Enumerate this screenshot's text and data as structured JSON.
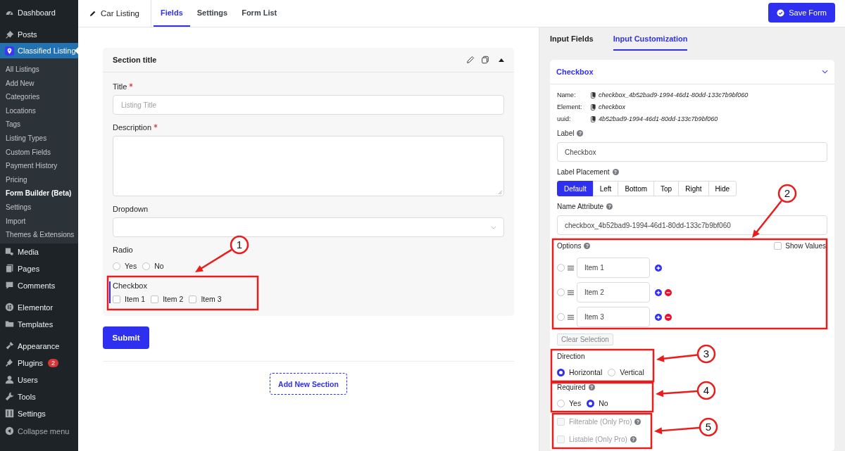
{
  "sidebar": {
    "groups": [
      {
        "items": [
          {
            "label": "Dashboard",
            "selected": false
          }
        ]
      },
      {
        "items": [
          {
            "label": "Posts",
            "selected": false
          },
          {
            "label": "Classified Listing",
            "selected": true,
            "children": [
              {
                "label": "All Listings",
                "selected": false
              },
              {
                "label": "Add New",
                "selected": false
              },
              {
                "label": "Categories",
                "selected": false
              },
              {
                "label": "Locations",
                "selected": false
              },
              {
                "label": "Tags",
                "selected": false
              },
              {
                "label": "Listing Types",
                "selected": false
              },
              {
                "label": "Custom Fields",
                "selected": false
              },
              {
                "label": "Payment History",
                "selected": false
              },
              {
                "label": "Pricing",
                "selected": false
              },
              {
                "label": "Form Builder (Beta)",
                "selected": true
              },
              {
                "label": "Settings",
                "selected": false
              },
              {
                "label": "Import",
                "selected": false
              },
              {
                "label": "Themes & Extensions",
                "selected": false
              }
            ]
          },
          {
            "label": "Media",
            "selected": false
          },
          {
            "label": "Pages",
            "selected": false
          },
          {
            "label": "Comments",
            "selected": false
          }
        ]
      },
      {
        "items": [
          {
            "label": "Elementor",
            "selected": false
          },
          {
            "label": "Templates",
            "selected": false
          }
        ]
      },
      {
        "items": [
          {
            "label": "Appearance",
            "selected": false
          },
          {
            "label": "Plugins",
            "selected": false,
            "badge": "2"
          },
          {
            "label": "Users",
            "selected": false
          },
          {
            "label": "Tools",
            "selected": false
          },
          {
            "label": "Settings",
            "selected": false
          }
        ]
      }
    ],
    "collapse": "Collapse menu"
  },
  "topbar": {
    "form_name": "Car Listing",
    "tabs": [
      {
        "label": "Fields",
        "selected": true
      },
      {
        "label": "Settings",
        "selected": false
      },
      {
        "label": "Form List",
        "selected": false
      }
    ],
    "save_button": "Save Form"
  },
  "section": {
    "title": "Section title",
    "fields": [
      {
        "kind": "text",
        "label": "Title",
        "required": true,
        "placeholder": "Listing Title"
      },
      {
        "kind": "textarea",
        "label": "Description",
        "required": true
      },
      {
        "kind": "select",
        "label": "Dropdown",
        "required": false
      },
      {
        "kind": "radio",
        "label": "Radio",
        "required": false,
        "options": [
          {
            "label": "Yes",
            "selected": false
          },
          {
            "label": "No",
            "selected": false
          }
        ]
      },
      {
        "kind": "checkbox",
        "label": "Checkbox",
        "required": false,
        "active": true,
        "options": [
          {
            "label": "Item 1",
            "checked": false
          },
          {
            "label": "Item 2",
            "checked": false
          },
          {
            "label": "Item 3",
            "checked": false
          }
        ]
      }
    ]
  },
  "submit_button": "Submit",
  "add_section_button": "Add New Section",
  "panel": {
    "tabs": [
      {
        "label": "Input Fields",
        "selected": false
      },
      {
        "label": "Input Customization",
        "selected": true
      }
    ],
    "card": {
      "title": "Checkbox",
      "expanded": true,
      "meta": [
        {
          "key": "Name:",
          "value": "checkbox_4b52bad9-1994-46d1-80dd-133c7b9bf060"
        },
        {
          "key": "Element:",
          "value": "checkbox"
        },
        {
          "key": "uuid:",
          "value": "4b52bad9-1994-46d1-80dd-133c7b9bf060"
        }
      ],
      "label_field": {
        "label": "Label",
        "help": "?",
        "value": "Checkbox"
      },
      "label_placement": {
        "label": "Label Placement",
        "help": "?",
        "options": [
          {
            "label": "Default",
            "selected": true
          },
          {
            "label": "Left",
            "selected": false
          },
          {
            "label": "Bottom",
            "selected": false
          },
          {
            "label": "Top",
            "selected": false
          },
          {
            "label": "Right",
            "selected": false
          },
          {
            "label": "Hide",
            "selected": false
          }
        ]
      },
      "name_attribute": {
        "label": "Name Attribute",
        "help": "?",
        "value": "checkbox_4b52bad9-1994-46d1-80dd-133c7b9bf060"
      },
      "options": {
        "label": "Options",
        "help": "?",
        "show_values": {
          "label": "Show Values",
          "checked": false
        },
        "items": [
          {
            "value": "Item 1",
            "selected": false,
            "removable": false
          },
          {
            "value": "Item 2",
            "selected": false,
            "removable": true
          },
          {
            "value": "Item 3",
            "selected": false,
            "removable": true
          }
        ]
      },
      "clear_button": {
        "label": "Clear Selection",
        "disabled": true
      },
      "direction": {
        "label": "Direction",
        "options": [
          {
            "label": "Horizontal",
            "selected": true
          },
          {
            "label": "Vertical",
            "selected": false
          }
        ]
      },
      "required": {
        "label": "Required",
        "help": "?",
        "options": [
          {
            "label": "Yes",
            "selected": false
          },
          {
            "label": "No",
            "selected": true
          }
        ]
      },
      "pro_options": [
        {
          "label": "Filterable (Only Pro)",
          "help": "?",
          "checked": false,
          "disabled": true
        },
        {
          "label": "Listable (Only Pro)",
          "help": "?",
          "checked": false,
          "disabled": true
        }
      ]
    }
  },
  "annotations": [
    {
      "number": "1"
    },
    {
      "number": "2"
    },
    {
      "number": "3"
    },
    {
      "number": "4"
    },
    {
      "number": "5"
    }
  ]
}
